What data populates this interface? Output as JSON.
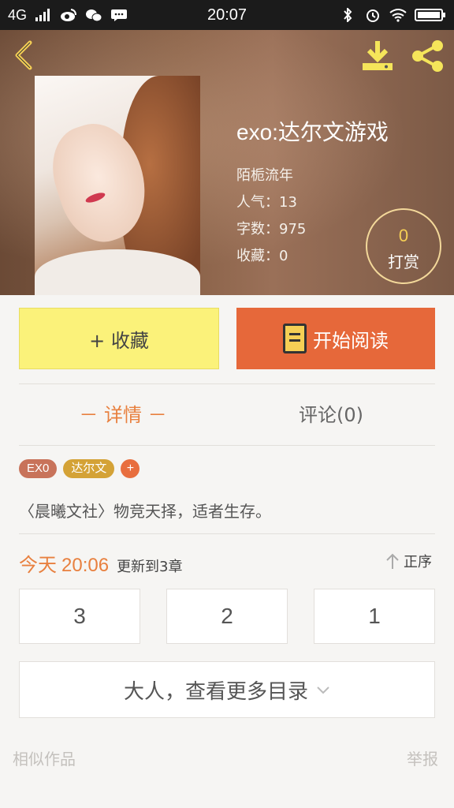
{
  "status_bar": {
    "network": "4G",
    "time": "20:07"
  },
  "book": {
    "title": "exo:达尔文游戏",
    "author": "陌栀流年",
    "popularity": "人气：13",
    "word_count": "字数：975",
    "collections": "收藏：0"
  },
  "reward": {
    "count": "0",
    "label": "打赏"
  },
  "actions": {
    "collect_label": "+ 收藏",
    "read_label": "开始阅读"
  },
  "tabs": [
    {
      "label": "－ 详情 －",
      "active": true
    },
    {
      "label": "评论(0)",
      "active": false
    }
  ],
  "tags": [
    "EX0",
    "达尔文",
    "+"
  ],
  "description": "〈晨曦文社〉物竞天择，适者生存。",
  "update": {
    "day": "今天",
    "time": "20:06",
    "text": "更新到3章",
    "sort_label": "正序"
  },
  "chapters": [
    "3",
    "2",
    "1"
  ],
  "more_catalog_label": "大人，查看更多目录",
  "footer": {
    "similar_label": "相似作品",
    "report_label": "举报"
  },
  "colors": {
    "accent": "#e8803f",
    "read_button": "#e6683a",
    "collect_button": "#fbf27a",
    "reward_count": "#f5cf55"
  }
}
